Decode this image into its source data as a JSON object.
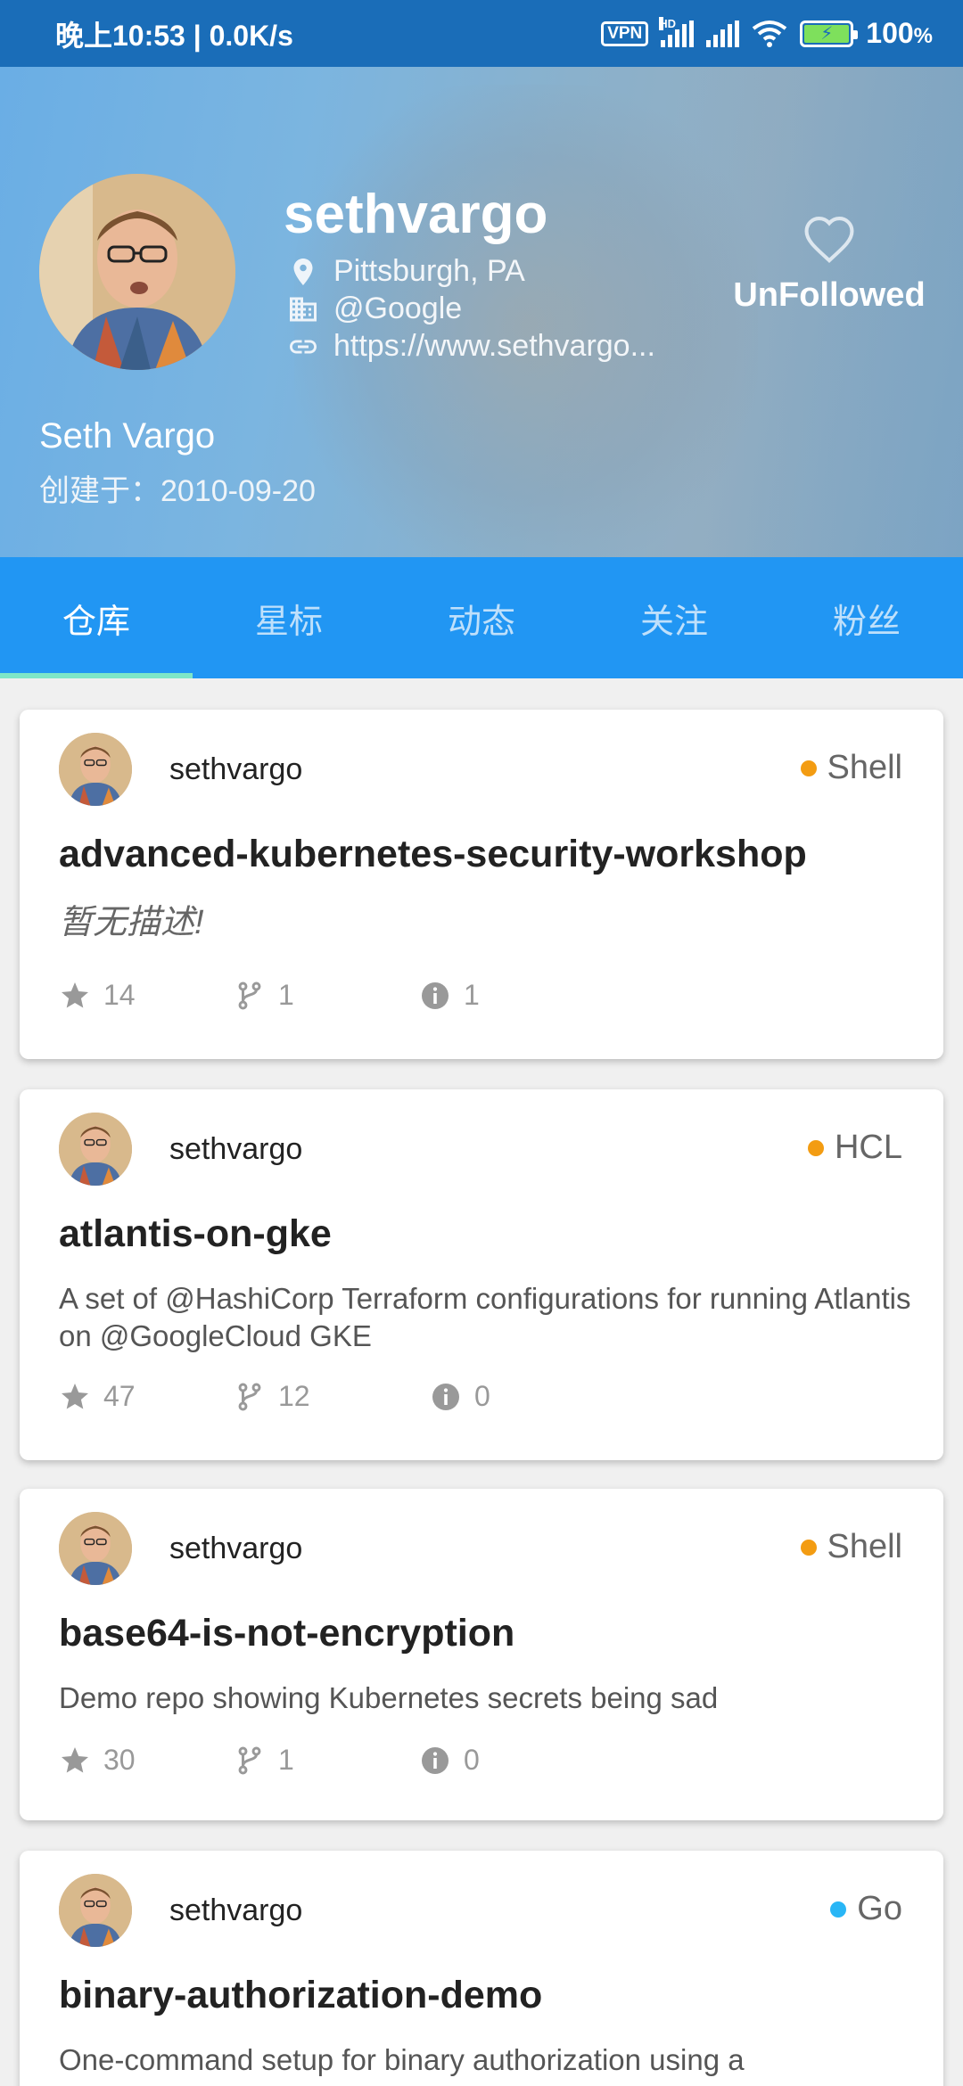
{
  "status_bar": {
    "left": "晚上10:53 | 0.0K/s",
    "vpn": "VPN",
    "hd": "HD",
    "battery": "100",
    "battery_unit": "%"
  },
  "profile": {
    "username": "sethvargo",
    "location": "Pittsburgh, PA",
    "company": "@Google",
    "blog": "https://www.sethvargo...",
    "follow_label": "UnFollowed",
    "real_name": "Seth Vargo",
    "created": "创建于：2010-09-20"
  },
  "tabs": [
    {
      "label": "仓库",
      "active": true
    },
    {
      "label": "星标",
      "active": false
    },
    {
      "label": "动态",
      "active": false
    },
    {
      "label": "关注",
      "active": false
    },
    {
      "label": "粉丝",
      "active": false
    }
  ],
  "repos": [
    {
      "owner": "sethvargo",
      "language": "Shell",
      "language_color": "#f39c12",
      "name": "advanced-kubernetes-security-workshop",
      "description": "暂无描述!",
      "stars": "14",
      "forks": "1",
      "issues": "1"
    },
    {
      "owner": "sethvargo",
      "language": "HCL",
      "language_color": "#f39c12",
      "name": "atlantis-on-gke",
      "description": "A set of @HashiCorp Terraform configurations for running Atlantis on @GoogleCloud GKE",
      "stars": "47",
      "forks": "12",
      "issues": "0"
    },
    {
      "owner": "sethvargo",
      "language": "Shell",
      "language_color": "#f39c12",
      "name": "base64-is-not-encryption",
      "description": "Demo repo showing Kubernetes secrets being sad",
      "stars": "30",
      "forks": "1",
      "issues": "0"
    },
    {
      "owner": "sethvargo",
      "language": "Go",
      "language_color": "#29b6f6",
      "name": "binary-authorization-demo",
      "description": "One-command setup for binary authorization using a"
    }
  ]
}
